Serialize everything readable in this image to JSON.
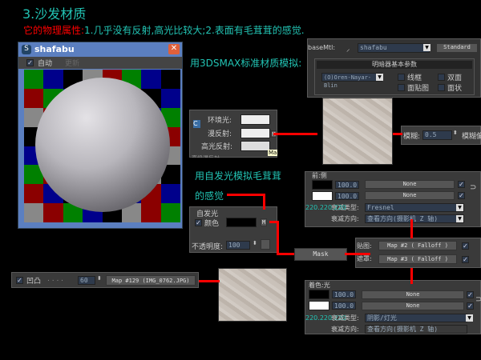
{
  "title": "3.沙发材质",
  "subtitle": {
    "label": "它的物理属性:",
    "text": "1.几乎没有反射,高光比较大;2.表面有毛茸茸的感觉."
  },
  "preview": {
    "window_title": "shafabu",
    "auto_label": "自动",
    "update_label": "更新",
    "checker": [
      "G",
      "B",
      "K",
      "Y",
      "R",
      "G",
      "B",
      "K",
      "R",
      "G",
      "B",
      "K",
      "Y",
      "R",
      "K",
      "B",
      "Y",
      "R",
      "G",
      "B",
      "K",
      "Y",
      "B",
      "G",
      "K",
      "Y",
      "B",
      "R",
      "G",
      "B",
      "G",
      "R",
      "B",
      "G",
      "K",
      "Y",
      "R",
      "B",
      "K",
      "Y",
      "G",
      "R",
      "Y",
      "B",
      "G",
      "K",
      "Y",
      "K",
      "R",
      "B",
      "K",
      "G",
      "Y",
      "B",
      "R",
      "B",
      "Y",
      "R",
      "G",
      "B",
      "K",
      "Y",
      "R",
      "G"
    ]
  },
  "notes": {
    "standard": "用3DSMAX标准材质模拟:",
    "selfillum_1": "用自发光模拟毛茸茸",
    "selfillum_2": "的感觉"
  },
  "material_panel": {
    "basemtl_label": "baseMtl:",
    "name": "shafabu",
    "type": "Standard",
    "rollout": "明暗器基本参数",
    "shader": "(O)Oren-Nayar-Blin",
    "wire": "线框",
    "two_sided": "双面",
    "face_map": "面贴图",
    "faceted": "面状"
  },
  "color_panel": {
    "ambient": "环境光:",
    "diffuse": "漫反射:",
    "specular": "高光反射:",
    "map_btn": "M",
    "tooltip": "Ma",
    "extra": "高级漫反射"
  },
  "blur_panel": {
    "label": "模糊:",
    "value": "0.5",
    "label2": "模糊偏"
  },
  "falloff1": {
    "header": "前:侧",
    "rows": [
      {
        "value": "100.0",
        "map": "None"
      },
      {
        "value": "100.0",
        "map": "None"
      }
    ],
    "rgb": "220.220.220",
    "type_label": "衰减类型:",
    "type": "Fresnel",
    "dir_label": "衰减方向:",
    "dir": "查看方向(摄影机 Z 轴)"
  },
  "selfillum": {
    "header": "自发光",
    "color_label": "颜色",
    "map_btn": "M",
    "opacity_label": "不透明度:",
    "opacity": "100"
  },
  "mask": {
    "label": "Mask"
  },
  "mask_panel": {
    "map_label": "贴图:",
    "map": "Map #2 ( Falloff )",
    "mask_label": "遮罩:",
    "mask": "Map #3 ( Falloff )"
  },
  "bump": {
    "label": "凹凸",
    "dots": ". . . .",
    "value": "60",
    "map": "Map #129 (IMG_0762.JPG)"
  },
  "falloff2": {
    "header": "着色:光",
    "rows": [
      {
        "value": "100.0",
        "map": "None"
      },
      {
        "value": "100.0",
        "map": "None"
      }
    ],
    "rgb": "220.220.220",
    "type_label": "衰减类型:",
    "type": "阴影/灯光",
    "dir_label": "衰减方向:",
    "dir": "查看方向(摄影机 Z 轴)"
  },
  "colors": {
    "accent": "#22c4b4",
    "red": "#ff0000"
  }
}
